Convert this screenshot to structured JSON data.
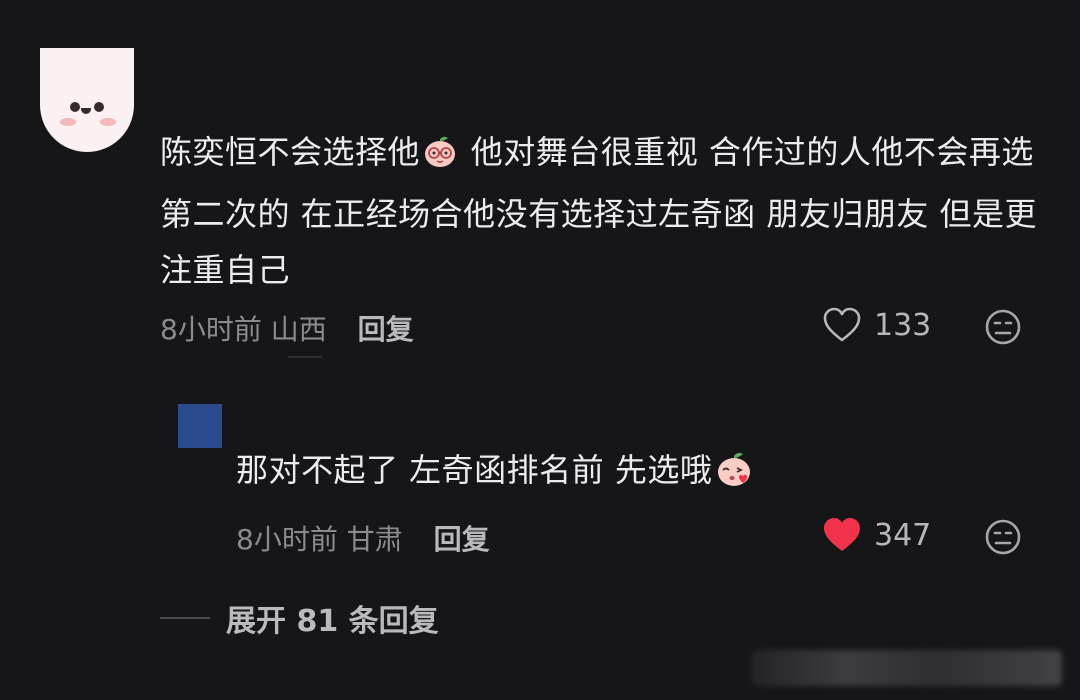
{
  "comment": {
    "text_part1": "陈奕恒不会选择他",
    "text_part2": " 他对舞台很重视 合作过的人他不会再选第二次的 在正经场合他没有选择过左奇函 朋友归朋友 但是更注重自己",
    "emoji_name": "peach-doll-glasses-emoji",
    "time": "8小时前",
    "location": "山西",
    "reply_label": "回复",
    "likes": "133",
    "liked": false
  },
  "reply": {
    "text": "那对不起了 左奇函排名前 先选哦",
    "emoji_name": "peach-doll-kiss-emoji",
    "time": "8小时前",
    "location": "甘肃",
    "reply_label": "回复",
    "likes": "347",
    "liked": true
  },
  "expand_label": "展开 81 条回复",
  "colors": {
    "background": "#161618",
    "liked_heart": "#f0334a",
    "reply_avatar": "#2c4b8e"
  }
}
